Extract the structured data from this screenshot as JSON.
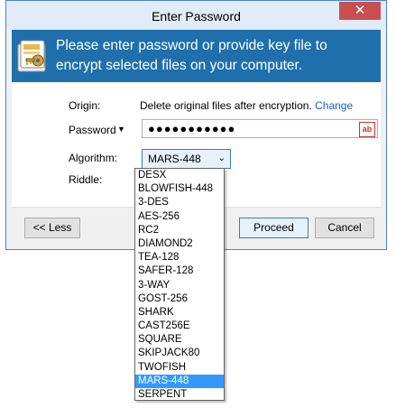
{
  "window": {
    "title": "Enter Password",
    "close_glyph": "✕"
  },
  "banner": {
    "text": "Please enter password or provide key file to encrypt selected files on your computer.",
    "icon": "key-folder-icon"
  },
  "form": {
    "origin_label": "Origin:",
    "origin_value": "Delete original files after encryption.",
    "origin_link": "Change",
    "password_label": "Password",
    "password_dropdown_glyph": "▼",
    "password_value": "●●●●●●●●●●●",
    "password_icon": "ab",
    "algorithm_label": "Algorithm:",
    "algorithm_value": "MARS-448",
    "algorithm_chevron": "⌄",
    "riddle_label": "Riddle:"
  },
  "buttons": {
    "less": "<< Less",
    "proceed": "Proceed",
    "cancel": "Cancel"
  },
  "algorithm_options": [
    "DESX",
    "BLOWFISH-448",
    "3-DES",
    "AES-256",
    "RC2",
    "DIAMOND2",
    "TEA-128",
    "SAFER-128",
    "3-WAY",
    "GOST-256",
    "SHARK",
    "CAST256E",
    "SQUARE",
    "SKIPJACK80",
    "TWOFISH",
    "MARS-448",
    "SERPENT"
  ],
  "selected_option": "MARS-448",
  "colors": {
    "banner_bg": "#1f6fac",
    "close_bg": "#c74f4f",
    "link": "#1a62b3",
    "selection": "#3399ff"
  }
}
